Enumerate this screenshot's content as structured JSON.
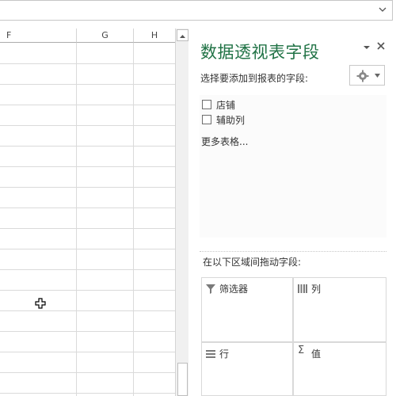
{
  "grid": {
    "columns": [
      "F",
      "G",
      "H"
    ]
  },
  "pivot_pane": {
    "title": "数据透视表字段",
    "choose_fields_label": "选择要添加到报表的字段:",
    "fields": [
      {
        "label": "店铺",
        "checked": false
      },
      {
        "label": "辅助列",
        "checked": false
      }
    ],
    "more_tables": "更多表格...",
    "drag_label": "在以下区域间拖动字段:",
    "areas": {
      "filters": "筛选器",
      "columns": "列",
      "rows": "行",
      "values": "值"
    }
  },
  "icons": {
    "pane_dropdown": "chevron-down-icon",
    "pane_close": "close-icon",
    "settings": "gear-icon",
    "filter": "filter-icon",
    "columns": "columns-icon",
    "rows": "rows-icon",
    "values": "sigma-icon"
  },
  "colors": {
    "title": "#217346"
  }
}
